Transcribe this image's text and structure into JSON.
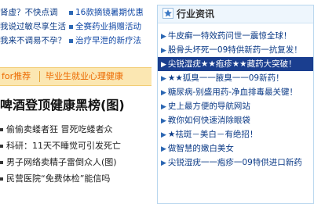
{
  "promo": {
    "left": [
      "肾虚？不快点调",
      "我说过敏尽享生活",
      "我来不调易不孕？"
    ],
    "right": [
      "16款摘镜暑期优惠",
      "全赛药业捐赠活动",
      "治疗早泄的新疗法"
    ]
  },
  "tabs": {
    "first": "for推荐",
    "second": "毕业生就业心理健康"
  },
  "headline": "啤酒登顶健康黑榜(图)",
  "news": [
    "偷偷卖蝼者狂 冒死吃蝼者众",
    "科研：11天不睡觉可引发死亡",
    "男子网络卖精子雷倒众人(图)",
    "民营医院“免费体检”能信吗"
  ],
  "right_panel": {
    "title": "行业资讯",
    "items": [
      "牛皮癣一特效药问世一震惊全球！",
      "股骨头坏死一09特供新药一抗复发！",
      "尖锐湿疣★★疱疹★★藏药大突破！",
      "★★狐臭一一腋臭一一09新药！",
      "糖尿病-别盛用药-净血排毒最关键！",
      "史上最方便的导航网站",
      "教你如何快速消除眼袋",
      "★祛斑－美白－有绝招！",
      "做智慧的嫩白美女",
      "尖锐湿疣一一疱疹一09特供进口新药"
    ],
    "highlighted_index": 2
  },
  "colors": {
    "accent": "#ec6a00",
    "link": "#0b3a86",
    "highlight_bg": "#1a3e8f"
  }
}
